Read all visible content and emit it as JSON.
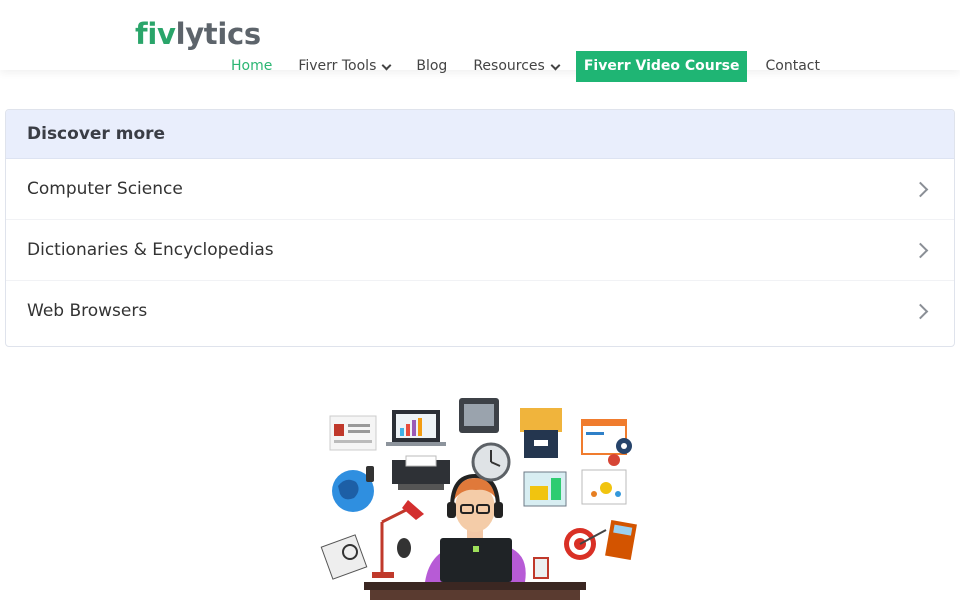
{
  "header": {
    "logo_part1": "fiv",
    "logo_part2": "lytics",
    "nav": {
      "home": "Home",
      "fiverr_tools": "Fiverr Tools",
      "blog": "Blog",
      "resources": "Resources",
      "video_course": "Fiverr Video Course",
      "contact": "Contact"
    }
  },
  "discover": {
    "title": "Discover more",
    "items": [
      {
        "label": "Computer Science"
      },
      {
        "label": "Dictionaries & Encyclopedias"
      },
      {
        "label": "Web Browsers"
      }
    ]
  },
  "colors": {
    "brand_green": "#2bb673",
    "cta_bg": "#1fb574",
    "discover_header_bg": "#e9eefc"
  },
  "illustration": {
    "icons": [
      "person-at-laptop",
      "globe-icon",
      "clock-icon",
      "target-icon",
      "monitor-icon",
      "gear-icon",
      "desk-lamp-icon",
      "calculator-icon",
      "notebook-icon",
      "briefcase-icon"
    ]
  }
}
